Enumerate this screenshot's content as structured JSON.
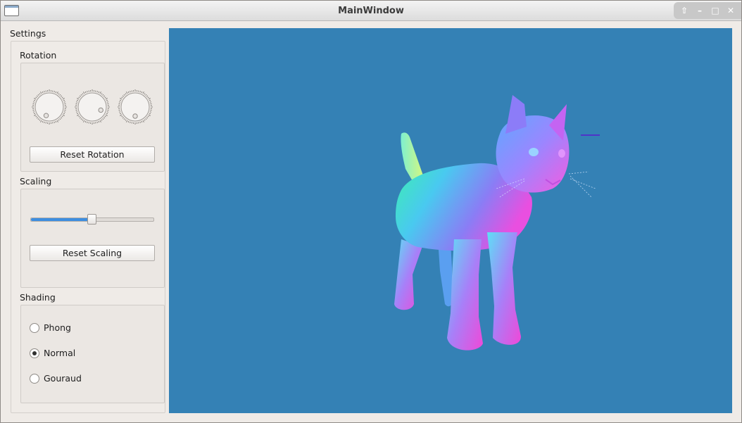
{
  "window": {
    "title": "MainWindow"
  },
  "settings": {
    "label": "Settings",
    "rotation": {
      "title": "Rotation",
      "reset_label": "Reset Rotation",
      "dials": [
        {
          "angle_deg": 200
        },
        {
          "angle_deg": 110
        },
        {
          "angle_deg": 180
        }
      ]
    },
    "scaling": {
      "title": "Scaling",
      "reset_label": "Reset Scaling",
      "slider_value": 0.5
    },
    "shading": {
      "title": "Shading",
      "options": [
        {
          "label": "Phong",
          "checked": false
        },
        {
          "label": "Normal",
          "checked": true
        },
        {
          "label": "Gouraud",
          "checked": false
        }
      ]
    }
  },
  "viewport": {
    "background": "#3481b5",
    "model": "cat"
  }
}
